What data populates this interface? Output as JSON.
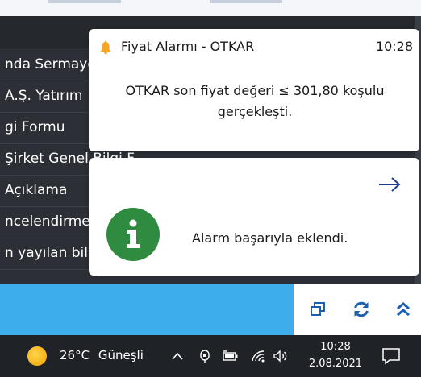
{
  "background_rows": [
    "nda Sermaye",
    "A.Ş. Yatırım",
    "gi Formu",
    "Şirket Genel Bilgi F",
    "Açıklama",
    "ncelendirmes",
    "n yayılan bilg"
  ],
  "toasts": {
    "price_alarm": {
      "title": "Fiyat Alarmı - OTKAR",
      "time": "10:28",
      "message": "OTKAR son fiyat değeri ≤ 301,80 koşulu gerçekleşti.",
      "icon": "bell-icon",
      "accent": "#f5a623"
    },
    "alarm_added": {
      "message": "Alarm başarıyla eklendi.",
      "icon": "info-icon",
      "action_icon": "arrow-right-icon",
      "accent": "#2e8b3f"
    }
  },
  "toolbar": {
    "icons": [
      "restore-window-icon",
      "refresh-icon",
      "collapse-up-icon"
    ],
    "accent": "#1a5fb4"
  },
  "taskbar": {
    "weather_temp": "26°C",
    "weather_desc": "Güneşli",
    "time": "10:28",
    "date": "2.08.2021",
    "tray_icons": [
      "chevron-up-icon",
      "pen-icon",
      "battery-icon",
      "wifi-icon",
      "volume-icon"
    ],
    "notification_icon": "notification-icon"
  }
}
